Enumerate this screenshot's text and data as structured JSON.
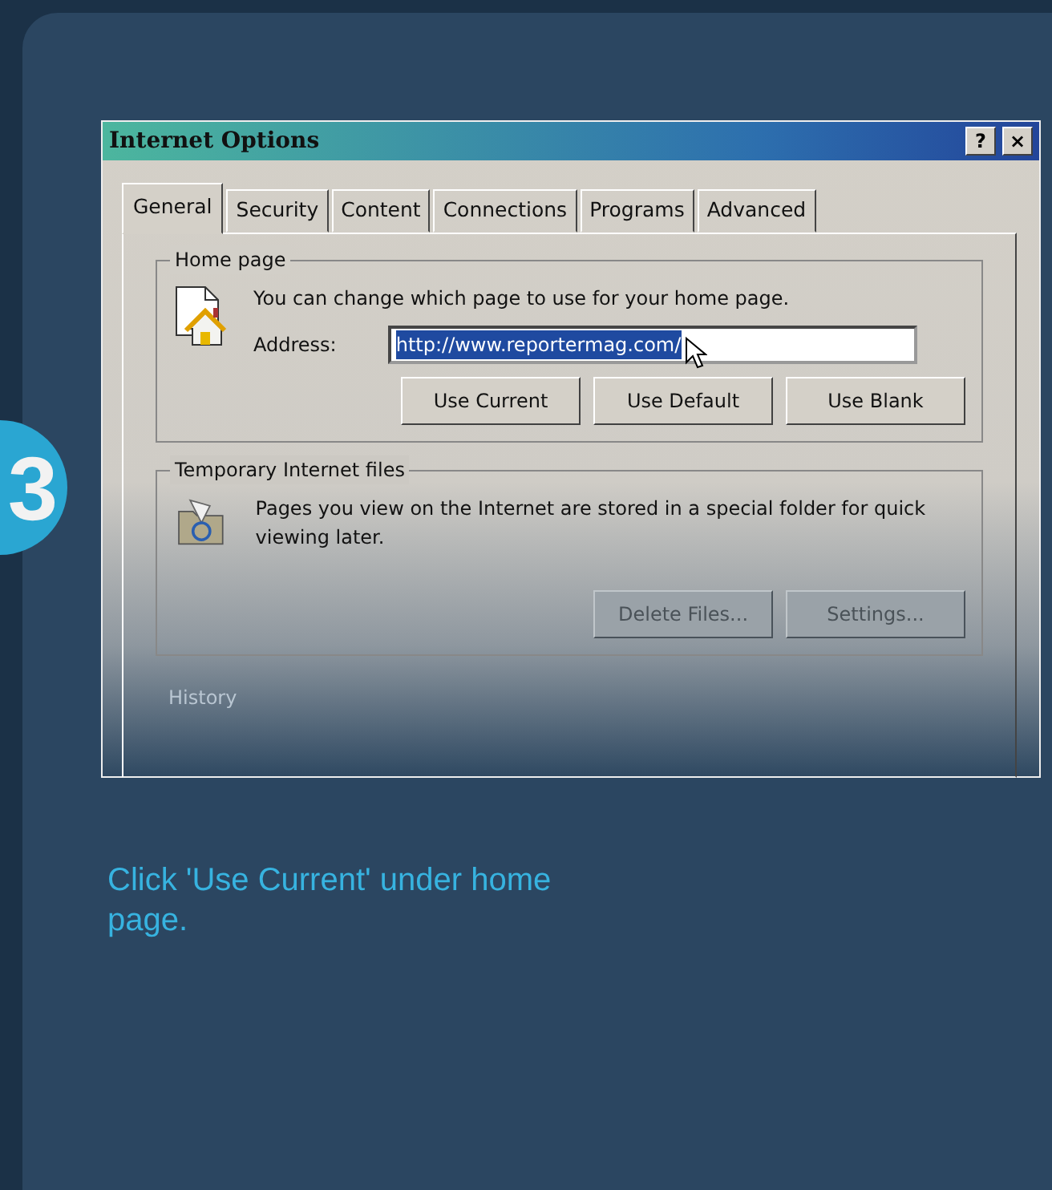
{
  "step_badge": "3",
  "dialog": {
    "title": "Internet Options",
    "title_buttons": [
      "?",
      "×"
    ],
    "tabs": [
      {
        "label": "General",
        "selected": true
      },
      {
        "label": "Security",
        "selected": false
      },
      {
        "label": "Content",
        "selected": false
      },
      {
        "label": "Connections",
        "selected": false
      },
      {
        "label": "Programs",
        "selected": false
      },
      {
        "label": "Advanced",
        "selected": false
      }
    ],
    "home_page": {
      "legend": "Home page",
      "description": "You can change which page to use for your home page.",
      "address_label": "Address:",
      "address_value": "http://www.reportermag.com/",
      "buttons": [
        "Use Current",
        "Use Default",
        "Use Blank"
      ]
    },
    "temporary_files": {
      "legend": "Temporary Internet files",
      "description": "Pages you view on the Internet are stored in a special folder for quick viewing later.",
      "buttons": [
        "Delete Files...",
        "Settings..."
      ]
    },
    "history": {
      "legend": "History"
    }
  },
  "caption": "Click 'Use Current' under home page."
}
